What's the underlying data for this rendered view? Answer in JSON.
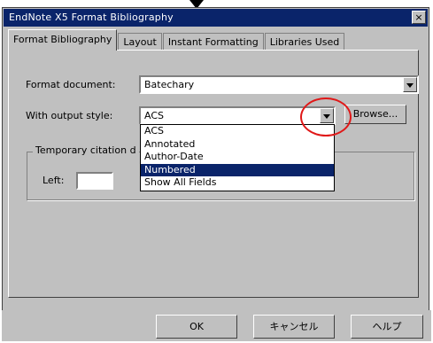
{
  "dialog": {
    "title": "EndNote X5 Format Bibliography",
    "close_label": "×"
  },
  "tabs": [
    {
      "label": "Format Bibliography",
      "active": true
    },
    {
      "label": "Layout",
      "active": false
    },
    {
      "label": "Instant Formatting",
      "active": false
    },
    {
      "label": "Libraries Used",
      "active": false
    }
  ],
  "format_document": {
    "label": "Format document:",
    "value": "Batechary"
  },
  "output_style": {
    "label": "With output style:",
    "value": "ACS",
    "browse_label": "Browse..."
  },
  "dropdown": {
    "options": [
      "ACS",
      "Annotated",
      "Author-Date",
      "Numbered",
      "Show All Fields"
    ],
    "highlighted": "Numbered"
  },
  "temporary_citation": {
    "group_label": "Temporary citation d",
    "left_label": "Left:",
    "left_value": ""
  },
  "buttons": {
    "ok": "OK",
    "cancel": "キャンセル",
    "help": "ヘルプ"
  }
}
